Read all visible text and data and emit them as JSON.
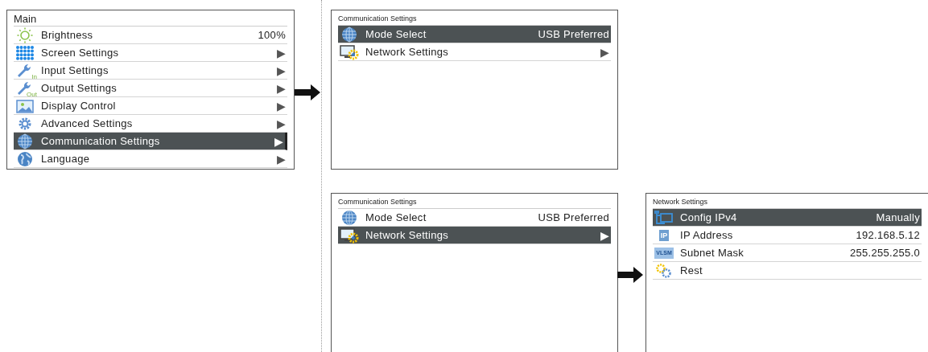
{
  "screens": [
    {
      "title": "Main",
      "items": [
        {
          "kind": "sun",
          "label": "Brightness",
          "value": "100%",
          "selected": false
        },
        {
          "kind": "dots",
          "label": "Screen Settings",
          "arrow": "▶",
          "selected": false
        },
        {
          "kind": "wrench",
          "icon_text": "In",
          "label": "Input Settings",
          "arrow": "▶",
          "selected": false
        },
        {
          "kind": "wrench",
          "icon_text": "Out",
          "label": "Output Settings",
          "arrow": "▶",
          "selected": false
        },
        {
          "kind": "picture",
          "label": "Display Control",
          "arrow": "▶",
          "selected": false
        },
        {
          "kind": "gear",
          "label": "Advanced Settings",
          "arrow": "▶",
          "selected": false
        },
        {
          "kind": "globe",
          "label": "Communication Settings",
          "arrow": "▶",
          "selected": true
        },
        {
          "kind": "earth",
          "label": "Language",
          "arrow": "▶",
          "selected": false
        }
      ]
    },
    {
      "title": "Communication Settings",
      "items": [
        {
          "kind": "globe",
          "label": "Mode Select",
          "value": "USB Preferred",
          "selected": true
        },
        {
          "kind": "monitor",
          "label": "Network Settings",
          "arrow": "▶",
          "selected": false
        }
      ]
    },
    {
      "title": "Communication Settings",
      "items": [
        {
          "kind": "globe",
          "label": "Mode Select",
          "value": "USB Preferred",
          "selected": false
        },
        {
          "kind": "monitor",
          "label": "Network Settings",
          "arrow": "▶",
          "selected": true
        }
      ]
    },
    {
      "title": "Network Settings",
      "items": [
        {
          "kind": "network",
          "label": "Config IPv4",
          "value": "Manually",
          "selected": true
        },
        {
          "kind": "tag",
          "icon_text": "IP",
          "label": "IP Address",
          "value": "192.168.5.12",
          "selected": false
        },
        {
          "kind": "tag",
          "icon_text": "VLSM",
          "label": "Subnet Mask",
          "value": "255.255.255.0",
          "selected": false
        },
        {
          "kind": "gears",
          "label": "Rest",
          "selected": false
        }
      ]
    }
  ]
}
